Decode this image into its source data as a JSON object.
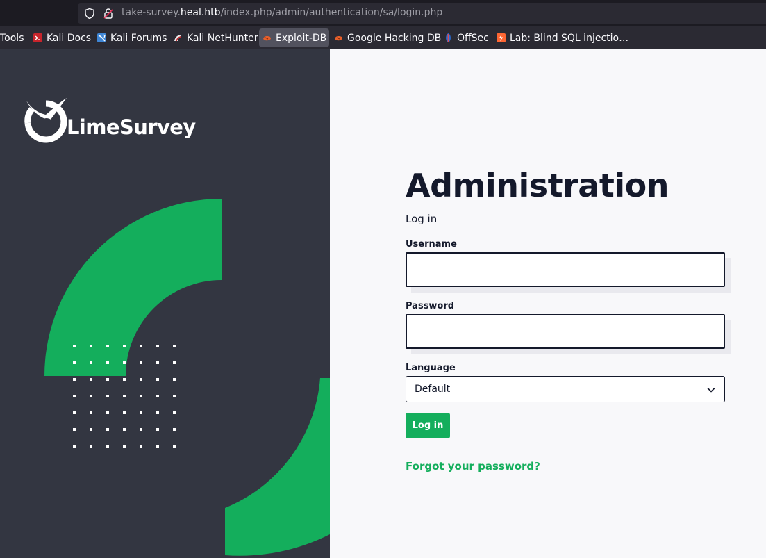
{
  "browser": {
    "url_prefix": "take-survey.",
    "url_host": "heal.htb",
    "url_path": "/index.php/admin/authentication/sa/login.php"
  },
  "bookmarks": [
    {
      "label": "Tools",
      "icon": "none"
    },
    {
      "label": "Kali Docs",
      "icon": "kali-docs-icon"
    },
    {
      "label": "Kali Forums",
      "icon": "kali-forums-icon"
    },
    {
      "label": "Kali NetHunter",
      "icon": "kali-nethunter-icon"
    },
    {
      "label": "Exploit-DB",
      "icon": "exploit-db-icon"
    },
    {
      "label": "Google Hacking DB",
      "icon": "google-hacking-db-icon"
    },
    {
      "label": "OffSec",
      "icon": "offsec-icon"
    },
    {
      "label": "Lab: Blind SQL injectio…",
      "icon": "portswigger-icon"
    }
  ],
  "brand": {
    "name": "LimeSurvey"
  },
  "login": {
    "title": "Administration",
    "subtitle": "Log in",
    "username_label": "Username",
    "username_value": "",
    "password_label": "Password",
    "password_value": "",
    "language_label": "Language",
    "language_selected": "Default",
    "submit_label": "Log in",
    "forgot_link": "Forgot your password?"
  },
  "colors": {
    "accent": "#14ae5c",
    "left_panel": "#333641",
    "text_dark": "#14192b"
  }
}
